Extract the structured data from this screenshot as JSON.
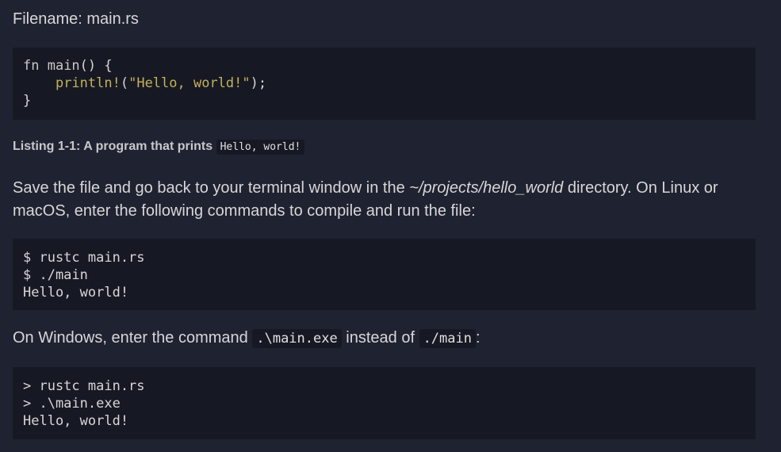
{
  "filename_label": "Filename: main.rs",
  "listing": {
    "lines": [
      {
        "kw": "fn ",
        "name": "main",
        "rest": "() {"
      },
      {
        "indent": "    ",
        "macro": "println!",
        "open": "(",
        "str": "\"Hello, world!\"",
        "close": ");"
      },
      {
        "text": "}"
      }
    ]
  },
  "caption": {
    "prefix": "Listing 1-1: A program that prints ",
    "code": "Hello, world!"
  },
  "para1": {
    "before": "Save the file and go back to your terminal window in the ",
    "path": "~/projects/hello_world",
    "after": " directory. On Linux or macOS, enter the following commands to compile and run the file:"
  },
  "unix_block": {
    "lines": [
      "$ rustc main.rs",
      "$ ./main",
      "Hello, world!"
    ]
  },
  "para2": {
    "before": "On Windows, enter the command ",
    "code1": ".\\main.exe",
    "middle": " instead of ",
    "code2": "./main",
    "after": ":"
  },
  "windows_block": {
    "lines": [
      "> rustc main.rs",
      "> .\\main.exe",
      "Hello, world!"
    ]
  }
}
